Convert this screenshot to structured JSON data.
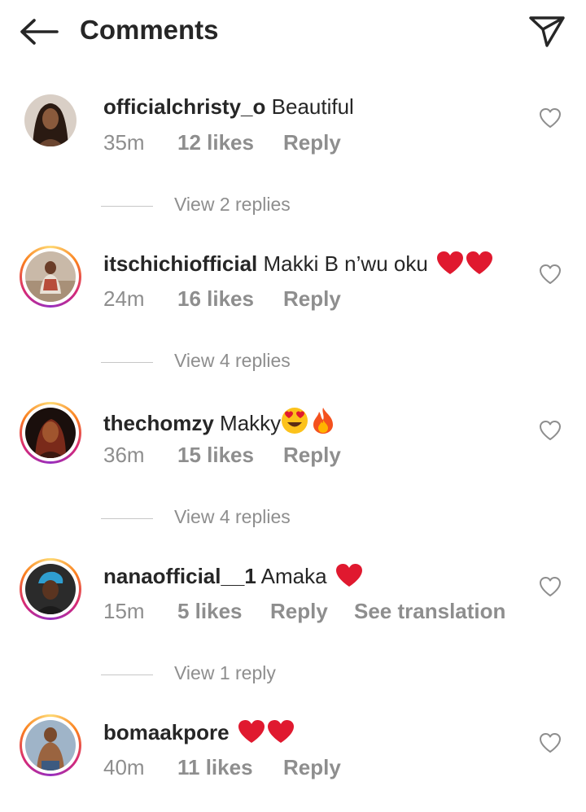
{
  "header": {
    "title": "Comments",
    "back_icon": "arrow-left-icon",
    "send_icon": "paper-plane-icon"
  },
  "comments": [
    {
      "username": "officialchristy_o",
      "text": "Beautiful",
      "emojis": [],
      "time": "35m",
      "likes": "12 likes",
      "reply": "Reply",
      "translate": "",
      "view_replies": "View 2 replies",
      "has_story_ring": false
    },
    {
      "username": "itschichiofficial",
      "text": "Makki B n’wu oku",
      "emojis": [
        "red-heart",
        "red-heart"
      ],
      "time": "24m",
      "likes": "16 likes",
      "reply": "Reply",
      "translate": "",
      "view_replies": "View 4 replies",
      "has_story_ring": true
    },
    {
      "username": "thechomzy",
      "text": "Makky",
      "emojis": [
        "heart-eyes",
        "fire"
      ],
      "time": "36m",
      "likes": "15 likes",
      "reply": "Reply",
      "translate": "",
      "view_replies": "View 4 replies",
      "has_story_ring": true
    },
    {
      "username": "nanaofficial__1",
      "text": "Amaka",
      "emojis": [
        "red-heart"
      ],
      "time": "15m",
      "likes": "5 likes",
      "reply": "Reply",
      "translate": "See translation",
      "view_replies": "View 1 reply",
      "has_story_ring": true
    },
    {
      "username": "bomaakpore",
      "text": "",
      "emojis": [
        "red-heart",
        "red-heart"
      ],
      "time": "40m",
      "likes": "11 likes",
      "reply": "Reply",
      "translate": "",
      "view_replies": "",
      "has_story_ring": true
    }
  ],
  "colors": {
    "text": "#262626",
    "secondary": "#8e8e8e",
    "heart_emoji": "#e0192f"
  }
}
